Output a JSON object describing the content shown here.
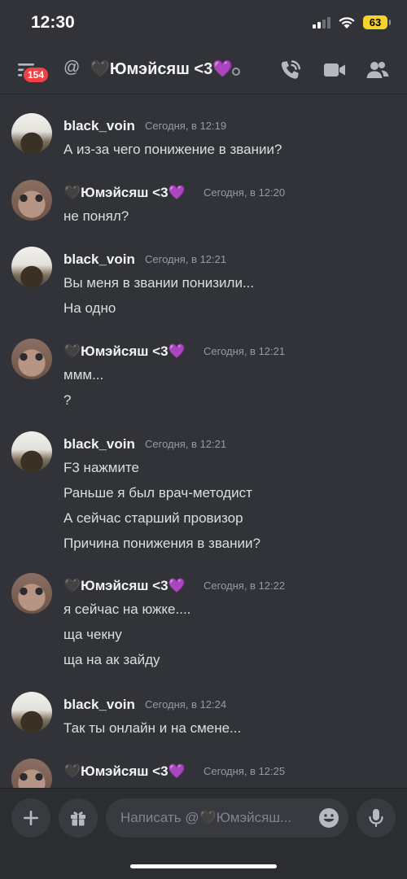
{
  "status_bar": {
    "time": "12:30",
    "battery": "63"
  },
  "header": {
    "notification_count": "154",
    "at_symbol": "@",
    "title": "🖤Юмэйсяш <3💜"
  },
  "messages": [
    {
      "author": "black_voin",
      "timestamp": "Сегодня, в 12:19",
      "lines": [
        "А из-за чего понижение в звании?"
      ]
    },
    {
      "author": "🖤Юмэйсяш <3💜",
      "timestamp": "Сегодня, в 12:20",
      "lines": [
        "не понял?"
      ]
    },
    {
      "author": "black_voin",
      "timestamp": "Сегодня, в 12:21",
      "lines": [
        "Вы меня в звании понизили...",
        "На одно"
      ]
    },
    {
      "author": "🖤Юмэйсяш <3💜",
      "timestamp": "Сегодня, в 12:21",
      "lines": [
        "ммм...",
        "?"
      ]
    },
    {
      "author": "black_voin",
      "timestamp": "Сегодня, в 12:21",
      "lines": [
        "F3 нажмите",
        "Раньше я был врач-методист",
        "А сейчас старший провизор",
        "Причина понижения в звании?"
      ]
    },
    {
      "author": "🖤Юмэйсяш <3💜",
      "timestamp": "Сегодня, в 12:22",
      "lines": [
        "я сейчас на южке....",
        "ща чекну",
        "ща на ак зайду"
      ]
    },
    {
      "author": "black_voin",
      "timestamp": "Сегодня, в 12:24",
      "lines": [
        "Так ты онлайн и на смене..."
      ]
    },
    {
      "author": "🖤Юмэйсяш <3💜",
      "timestamp": "Сегодня, в 12:25",
      "lines": []
    }
  ],
  "composer": {
    "placeholder": "Написать @🖤Юмэйсяш..."
  },
  "colors": {
    "background": "#313338",
    "composer": "#2b2d31",
    "badge": "#f23f42",
    "battery": "#f5d32b"
  },
  "icons": [
    "menu-icon",
    "call-icon",
    "video-icon",
    "members-icon",
    "plus-icon",
    "gift-icon",
    "emoji-icon",
    "microphone-icon"
  ]
}
